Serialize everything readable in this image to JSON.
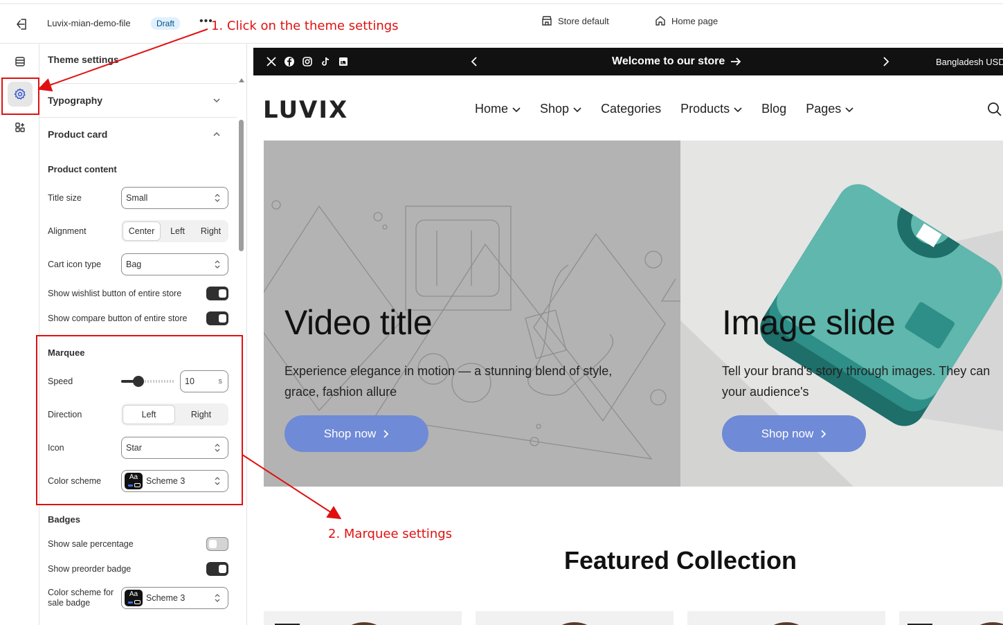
{
  "topbar": {
    "file_name": "Luvix-mian-demo-file",
    "status_badge": "Draft",
    "more_label": "•••",
    "store_default": "Store default",
    "home_page": "Home page"
  },
  "rail": {
    "items": [
      "sections",
      "theme-settings",
      "apps"
    ],
    "active": "theme-settings"
  },
  "panel": {
    "title": "Theme settings",
    "typography": "Typography",
    "product_card": "Product card",
    "product_content": "Product content",
    "title_size_label": "Title size",
    "title_size_value": "Small",
    "alignment_label": "Alignment",
    "alignment_options": [
      "Center",
      "Left",
      "Right"
    ],
    "alignment_selected": "Center",
    "cart_icon_label": "Cart icon type",
    "cart_icon_value": "Bag",
    "wishlist_label": "Show wishlist button of entire store",
    "wishlist_on": true,
    "compare_label": "Show compare button of entire store",
    "compare_on": true,
    "marquee": "Marquee",
    "speed_label": "Speed",
    "speed_value": "10",
    "speed_unit": "s",
    "direction_label": "Direction",
    "direction_options": [
      "Left",
      "Right"
    ],
    "direction_selected": "Left",
    "icon_label": "Icon",
    "icon_value": "Star",
    "color_scheme_label": "Color scheme",
    "color_scheme_value": "Scheme 3",
    "scheme_chip": "Aa",
    "badges": "Badges",
    "sale_pct_label": "Show sale percentage",
    "sale_pct_on": false,
    "preorder_label": "Show preorder badge",
    "preorder_on": true,
    "sale_scheme_label": "Color scheme for sale badge",
    "sale_scheme_value": "Scheme 3"
  },
  "preview": {
    "announcement": "Welcome to our store",
    "locale": "Bangladesh USD",
    "social_icons": [
      "x-icon",
      "facebook-icon",
      "instagram-icon",
      "tiktok-icon",
      "linkedin-icon"
    ],
    "logo": "LUVIX",
    "nav": [
      {
        "label": "Home",
        "dropdown": true
      },
      {
        "label": "Shop",
        "dropdown": true
      },
      {
        "label": "Categories",
        "dropdown": false
      },
      {
        "label": "Products",
        "dropdown": true
      },
      {
        "label": "Blog",
        "dropdown": false
      },
      {
        "label": "Pages",
        "dropdown": true
      }
    ],
    "slide1": {
      "title": "Video title",
      "text_line1": "Experience elegance in motion — a stunning blend of style,",
      "text_line2": "grace, fashion allure",
      "button": "Shop now"
    },
    "slide2": {
      "title": "Image slide",
      "text_line1": "Tell your brand's story through images. They can",
      "text_line2": "your audience's",
      "button": "Shop now"
    },
    "featured_title": "Featured Collection"
  },
  "annotations": {
    "step1": "1. Click on the theme settings",
    "step2": "2. Marquee settings",
    "color": "#e01010"
  }
}
